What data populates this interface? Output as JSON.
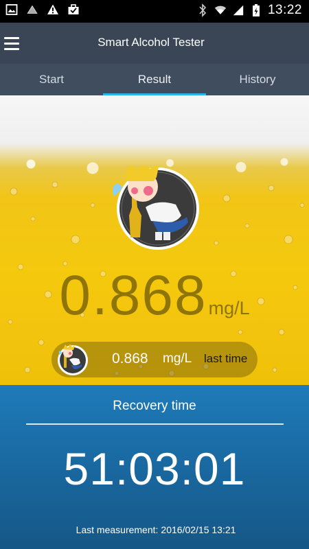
{
  "status_bar": {
    "time": "13:22",
    "left_icons": [
      "image-icon",
      "cloud-icon",
      "warning-icon",
      "briefcase-icon"
    ],
    "right_icons": [
      "bluetooth-icon",
      "wifi-icon",
      "signal-icon",
      "battery-charging-icon"
    ]
  },
  "app_bar": {
    "title": "Smart Alcohol Tester"
  },
  "tabs": [
    {
      "label": "Start",
      "active": false
    },
    {
      "label": "Result",
      "active": true
    },
    {
      "label": "History",
      "active": false
    }
  ],
  "result": {
    "value": "0.868",
    "unit": "mg/L"
  },
  "last_time": {
    "value": "0.868",
    "unit": "mg/L",
    "label": "last time"
  },
  "recovery": {
    "title": "Recovery time",
    "time": "51:03:01",
    "last_measurement_label": "Last measurement:",
    "last_measurement_value": "2016/02/15 13:21"
  },
  "colors": {
    "app_bar": "#3a4655",
    "tab_bar": "#3f4d5e",
    "tab_indicator": "#27b7e6",
    "beer": "#f3c40e",
    "reading_text": "#8f7408",
    "recovery_bg": "#1a6aa3"
  }
}
